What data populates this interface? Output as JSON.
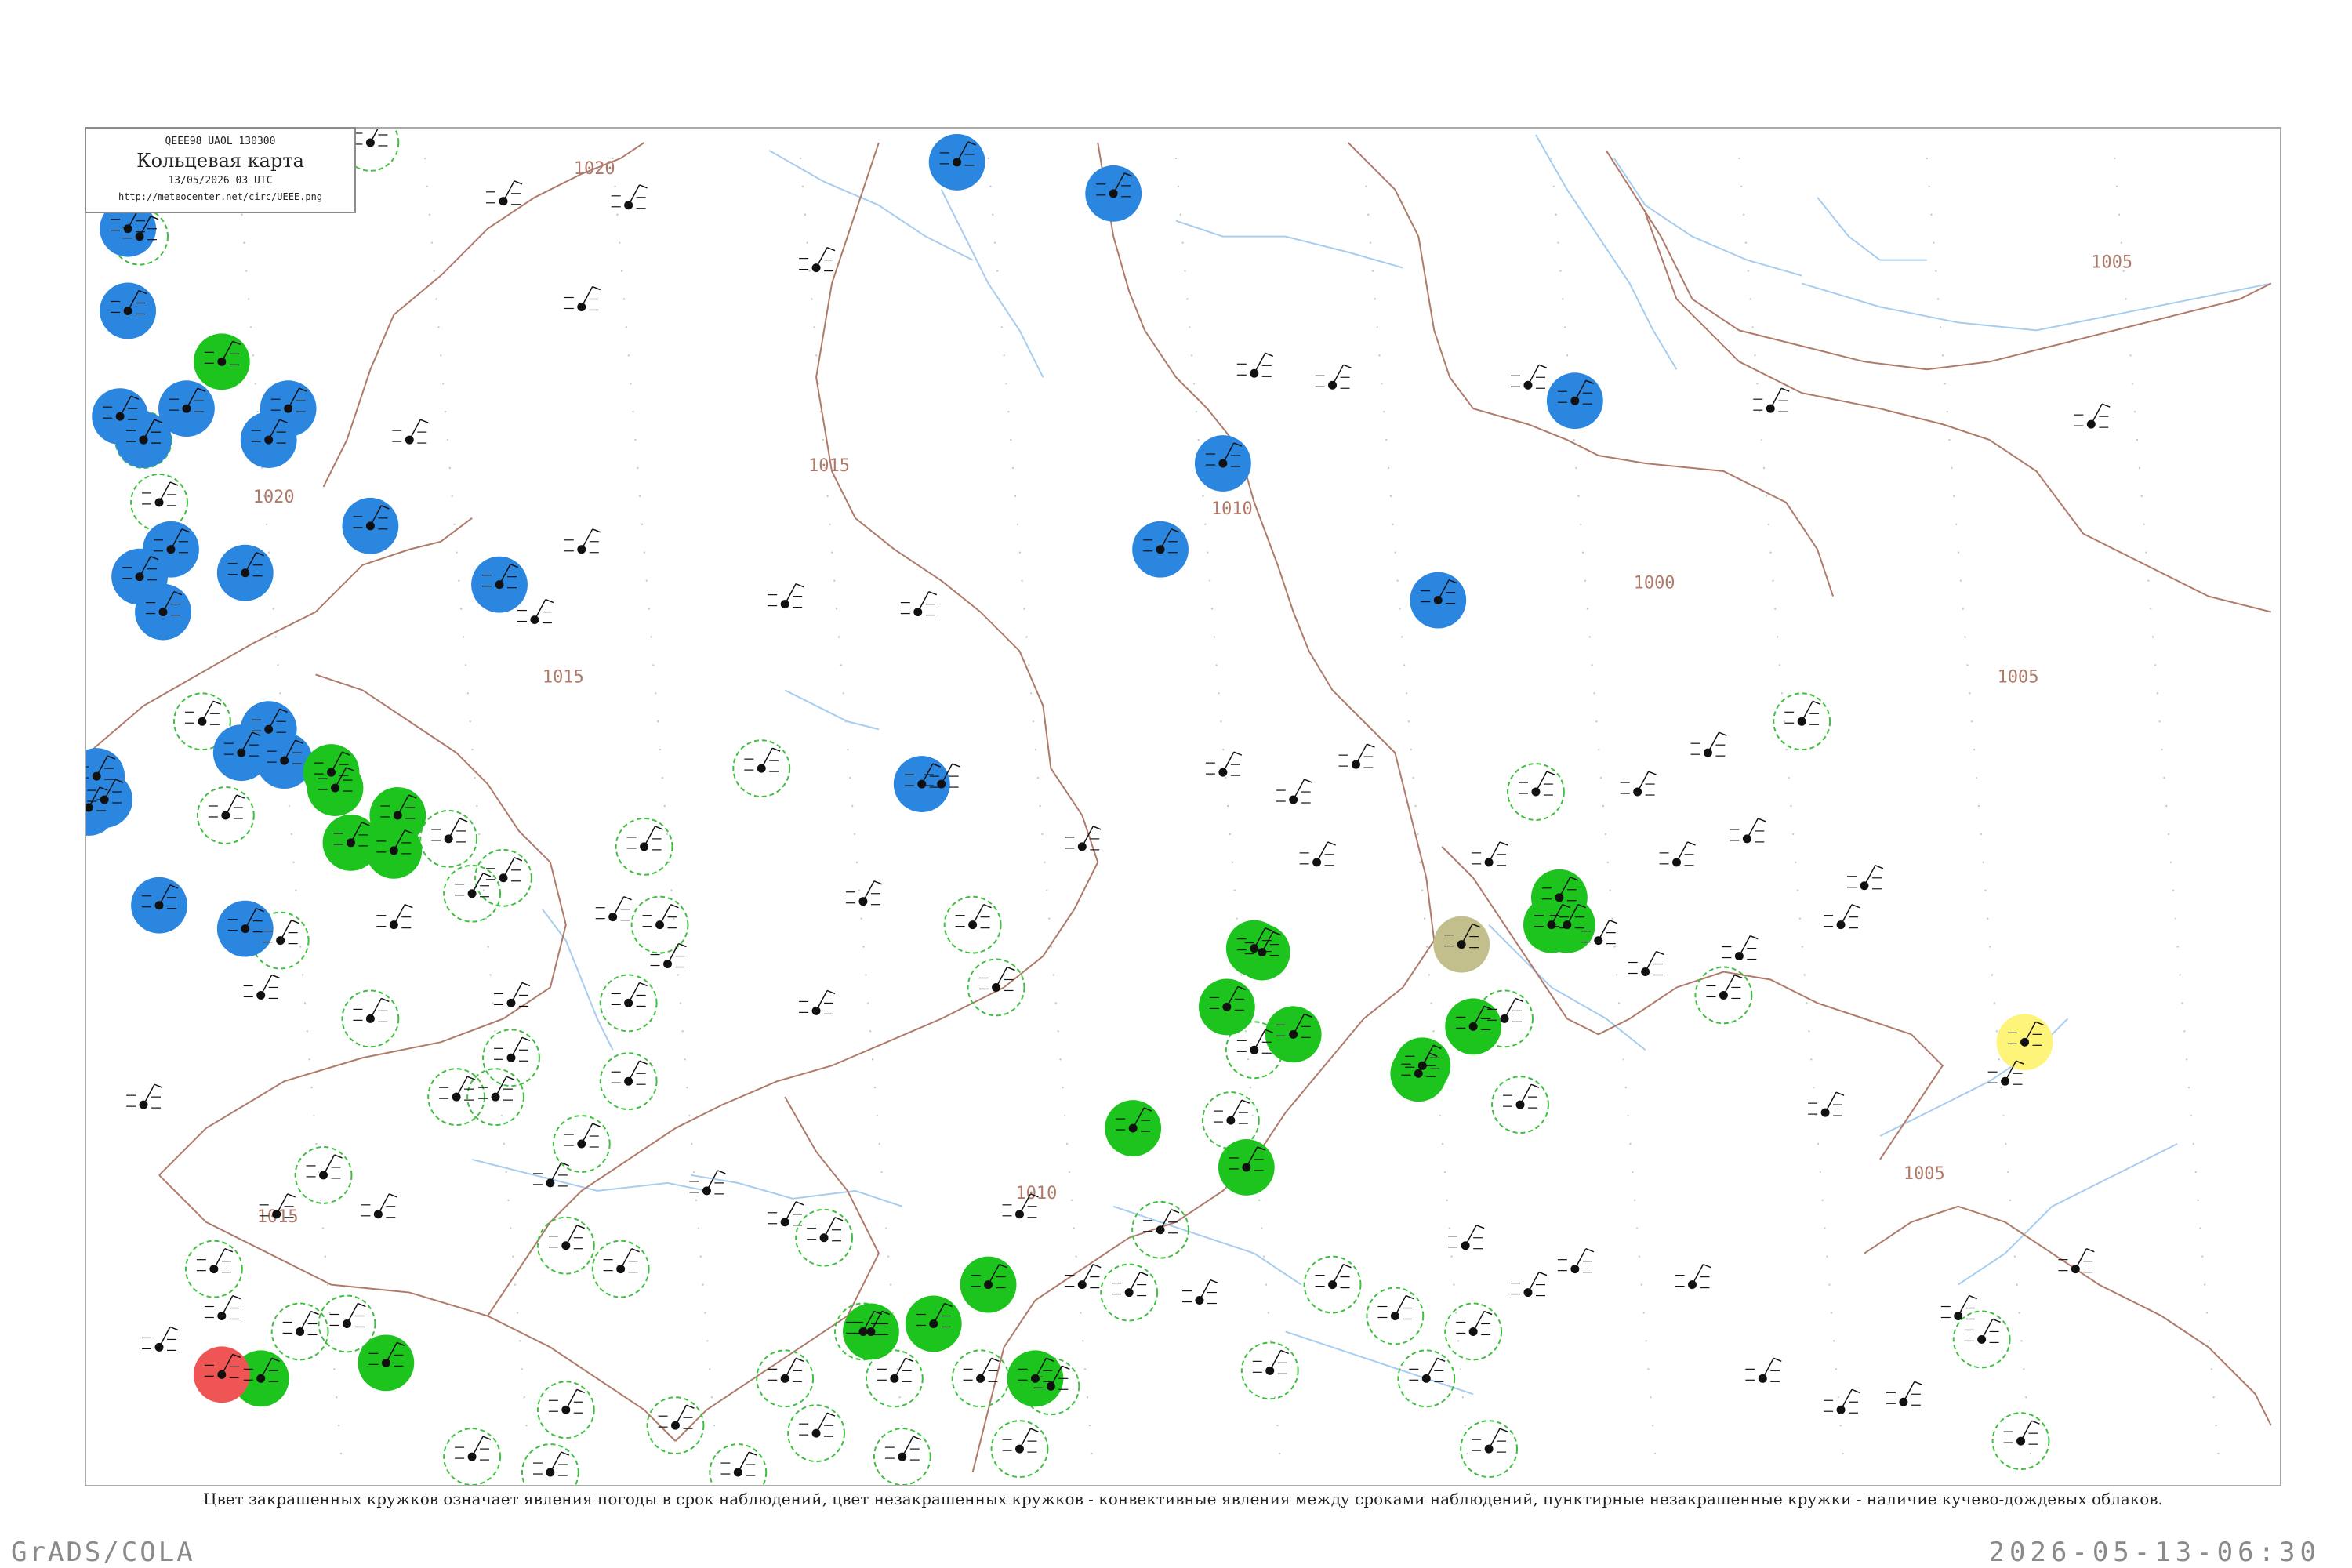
{
  "header": {
    "code_line": "QEEE98  UAOL  130300",
    "title": "Кольцевая карта",
    "date_line": "13/05/2026 03 UTC",
    "url": "http://meteocenter.net/circ/UEEE.png"
  },
  "isobars": [
    {
      "label": "1020"
    },
    {
      "label": "1020"
    },
    {
      "label": "1015"
    },
    {
      "label": "1015"
    },
    {
      "label": "1015"
    },
    {
      "label": "1010"
    },
    {
      "label": "1010"
    },
    {
      "label": "1005"
    },
    {
      "label": "1005"
    },
    {
      "label": "1005"
    },
    {
      "label": "1000"
    }
  ],
  "stations_shaded": [
    {
      "fill": "blue"
    },
    {
      "fill": "blue"
    },
    {
      "fill": "blue"
    },
    {
      "fill": "blue"
    },
    {
      "fill": "blue"
    },
    {
      "fill": "blue"
    },
    {
      "fill": "blue"
    },
    {
      "fill": "blue"
    },
    {
      "fill": "blue"
    },
    {
      "fill": "blue"
    },
    {
      "fill": "blue"
    },
    {
      "fill": "blue"
    },
    {
      "fill": "blue"
    },
    {
      "fill": "blue"
    },
    {
      "fill": "blue"
    },
    {
      "fill": "blue"
    },
    {
      "fill": "blue"
    },
    {
      "fill": "blue"
    },
    {
      "fill": "blue"
    },
    {
      "fill": "blue"
    },
    {
      "fill": "blue"
    },
    {
      "fill": "blue"
    },
    {
      "fill": "blue"
    },
    {
      "fill": "blue"
    },
    {
      "fill": "blue"
    },
    {
      "fill": "blue"
    },
    {
      "fill": "blue"
    },
    {
      "fill": "blue"
    },
    {
      "fill": "green"
    },
    {
      "fill": "green"
    },
    {
      "fill": "green"
    },
    {
      "fill": "green"
    },
    {
      "fill": "green"
    },
    {
      "fill": "green"
    },
    {
      "fill": "green"
    },
    {
      "fill": "green"
    },
    {
      "fill": "green"
    },
    {
      "fill": "green"
    },
    {
      "fill": "green"
    },
    {
      "fill": "green"
    },
    {
      "fill": "green"
    },
    {
      "fill": "green"
    },
    {
      "fill": "green"
    },
    {
      "fill": "green"
    },
    {
      "fill": "green"
    },
    {
      "fill": "green"
    },
    {
      "fill": "green"
    },
    {
      "fill": "green"
    },
    {
      "fill": "green"
    },
    {
      "fill": "green"
    },
    {
      "fill": "green"
    },
    {
      "fill": "green"
    },
    {
      "fill": "red"
    },
    {
      "fill": "yellow"
    },
    {
      "fill": "olive"
    }
  ],
  "fill_colors": {
    "blue": "#2b86e0",
    "green": "#1ec41e",
    "red": "#ef5555",
    "yellow": "#fff47a",
    "olive": "#c2bf8c"
  },
  "isobar_color": "#b07a6a",
  "river_color": "#a6cdf0",
  "ring_color": "#3fbf3f",
  "caption": "Цвет закрашенных кружков означает явления погоды в срок наблюдений, цвет незакрашенных кружков - конвективные явления между сроками наблюдений, пунктирные незакрашенные кружки - наличие кучево-дождевых облаков.",
  "footer": {
    "software": "GrADS/COLA",
    "timestamp": "2026-05-13-06:30"
  }
}
